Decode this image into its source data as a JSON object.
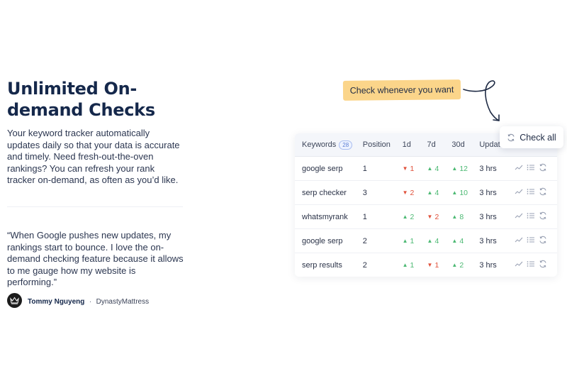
{
  "hero": {
    "title": "Unlimited On-demand Checks",
    "description": "Your keyword tracker automatically updates daily so that your data is accurate and timely. Need fresh-out-the-oven rankings? You can refresh your rank tracker on-demand, as often as you’d like."
  },
  "testimonial": {
    "quote": "“When Google pushes new updates, my rankings start to bounce. I love the on-demand checking feature because it allows to me gauge how my website is performing.”",
    "author_name": "Tommy Nguyeng",
    "separator": "·",
    "author_company": "DynastyMattress"
  },
  "callout": {
    "label": "Check whenever you want"
  },
  "check_all_button": {
    "label": "Check all"
  },
  "table": {
    "headers": {
      "keywords": "Keywords",
      "keyword_count": "28",
      "position": "Position",
      "d1": "1d",
      "d7": "7d",
      "d30": "30d",
      "updated": "Updated"
    },
    "rows": [
      {
        "keyword": "google serp",
        "position": "1",
        "d1": {
          "dir": "down",
          "arrow": "▼",
          "value": "1"
        },
        "d7": {
          "dir": "up",
          "arrow": "▲",
          "value": "4"
        },
        "d30": {
          "dir": "up",
          "arrow": "▲",
          "value": "12"
        },
        "updated": "3 hrs"
      },
      {
        "keyword": "serp checker",
        "position": "3",
        "d1": {
          "dir": "down",
          "arrow": "▼",
          "value": "2"
        },
        "d7": {
          "dir": "up",
          "arrow": "▲",
          "value": "4"
        },
        "d30": {
          "dir": "up",
          "arrow": "▲",
          "value": "10"
        },
        "updated": "3 hrs"
      },
      {
        "keyword": "whatsmyrank",
        "position": "1",
        "d1": {
          "dir": "up",
          "arrow": "▲",
          "value": "2"
        },
        "d7": {
          "dir": "down",
          "arrow": "▼",
          "value": "2"
        },
        "d30": {
          "dir": "up",
          "arrow": "▲",
          "value": "8"
        },
        "updated": "3 hrs"
      },
      {
        "keyword": "google serp",
        "position": "2",
        "d1": {
          "dir": "up",
          "arrow": "▲",
          "value": "1"
        },
        "d7": {
          "dir": "up",
          "arrow": "▲",
          "value": "4"
        },
        "d30": {
          "dir": "up",
          "arrow": "▲",
          "value": "4"
        },
        "updated": "3 hrs"
      },
      {
        "keyword": "serp results",
        "position": "2",
        "d1": {
          "dir": "up",
          "arrow": "▲",
          "value": "1"
        },
        "d7": {
          "dir": "down",
          "arrow": "▼",
          "value": "1"
        },
        "d30": {
          "dir": "up",
          "arrow": "▲",
          "value": "2"
        },
        "updated": "3 hrs"
      }
    ],
    "row_action_icons": [
      "trend-line-icon",
      "list-icon",
      "refresh-icon"
    ]
  },
  "colors": {
    "up": "#4cb973",
    "down": "#e0513b",
    "highlight": "#fbd58a",
    "title": "#15284b",
    "badge": "#5c7ed4"
  }
}
